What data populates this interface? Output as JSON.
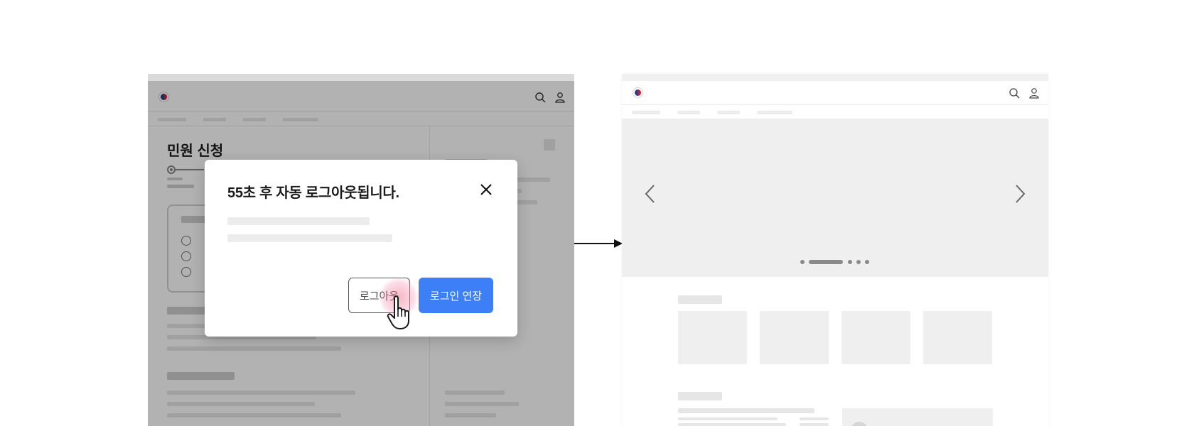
{
  "left_screen": {
    "page_title": "민원 신청",
    "icons": [
      "gov-logo-icon",
      "search-icon",
      "user-icon"
    ]
  },
  "modal": {
    "title": "55초 후 자동 로그아웃됩니다.",
    "logout_label": "로그아웃",
    "extend_label": "로그인 연장",
    "accent_color": "#3d7ff7"
  },
  "right_screen": {
    "icons": [
      "gov-logo-icon",
      "search-icon",
      "user-icon",
      "chevron-left-icon",
      "chevron-right-icon"
    ],
    "carousel": {
      "slide_count": 5,
      "active_index": 0
    }
  }
}
